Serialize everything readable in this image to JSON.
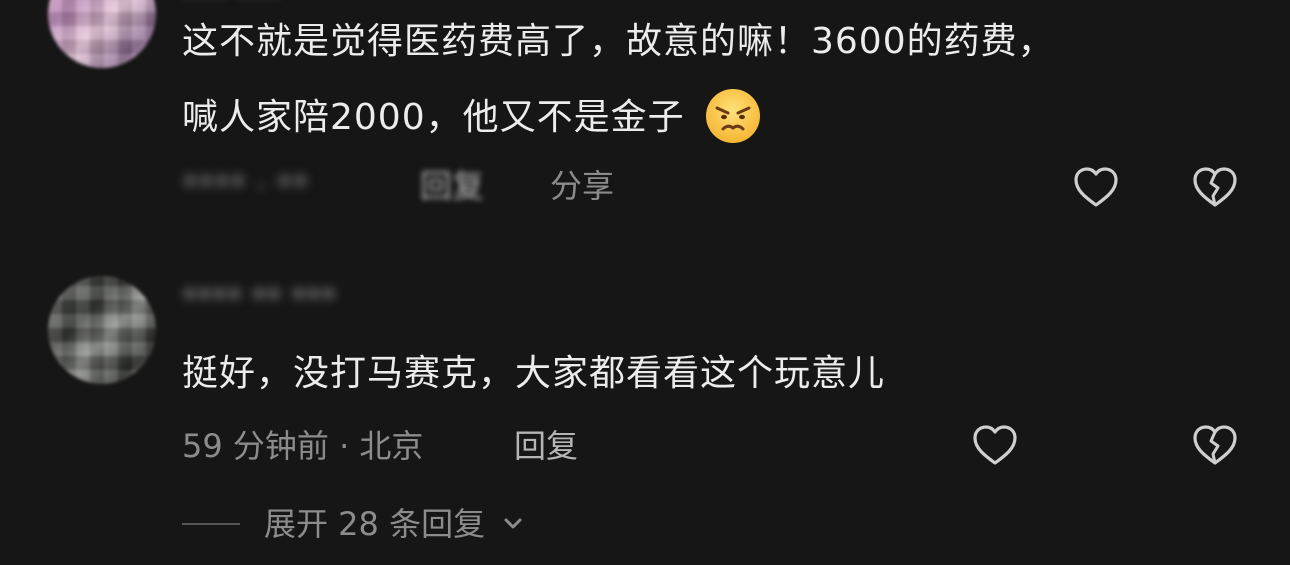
{
  "comments": [
    {
      "username": "*** ***",
      "text_line1": "这不就是觉得医药费高了，故意的嘛！3600的药费，",
      "text_line2": "喊人家陪2000，他又不是金子",
      "emoji": "angry-face-emoji",
      "time": "**** · **",
      "reply_label": "回复",
      "share_label": "分享"
    },
    {
      "username": "**** ** ***",
      "text": "挺好，没打马赛克，大家都看看这个玩意儿",
      "time_location": "59 分钟前 · 北京",
      "reply_label": "回复",
      "expand_label": "展开 28 条回复"
    }
  ],
  "colors": {
    "background": "#161616",
    "text": "#ececec",
    "meta": "#8c8c8c",
    "icon": "#cfcfcf"
  },
  "icons": [
    "heart-icon",
    "broken-heart-icon",
    "chevron-down-icon"
  ]
}
